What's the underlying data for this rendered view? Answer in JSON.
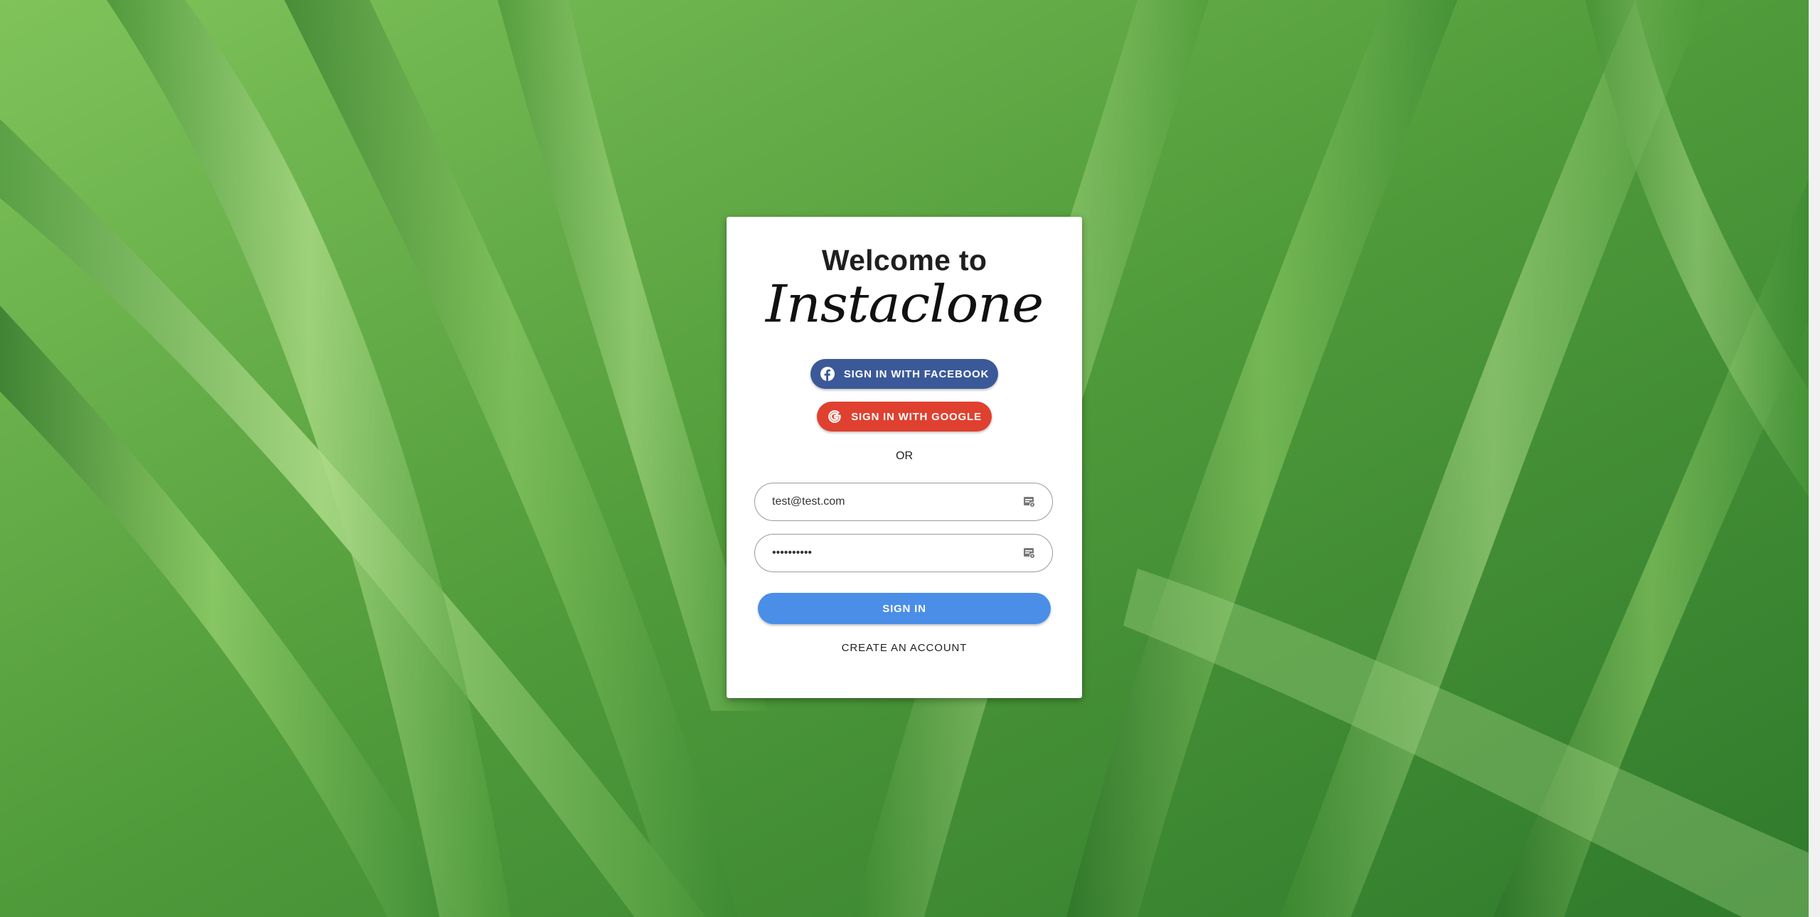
{
  "card": {
    "welcome_text": "Welcome to",
    "brand_name": "Instaclone"
  },
  "social": {
    "facebook_label": "SIGN IN WITH FACEBOOK",
    "google_label": "SIGN IN WITH GOOGLE",
    "facebook_color": "#3b5998",
    "google_color": "#e0402f"
  },
  "divider": {
    "or_text": "OR"
  },
  "form": {
    "email_value": "test@test.com",
    "password_value": "••••••••••",
    "signin_label": "SIGN IN",
    "signin_color": "#4a8ee8",
    "create_account_label": "CREATE AN ACCOUNT"
  },
  "icons": {
    "facebook": "facebook-icon",
    "google": "google-icon",
    "password_manager": "password-manager-icon"
  }
}
